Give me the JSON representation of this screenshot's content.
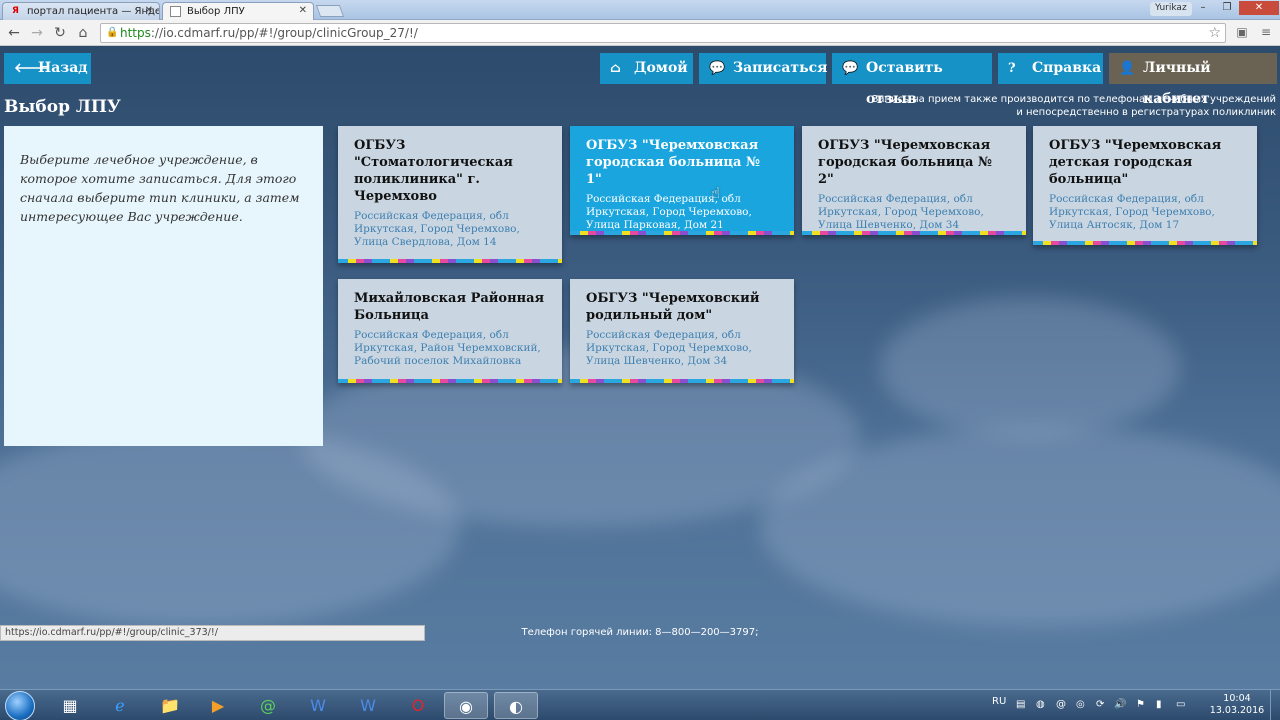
{
  "browser": {
    "tabs": [
      {
        "title": "портал пациента — Янде",
        "icon": "yandex-icon"
      },
      {
        "title": "Выбор ЛПУ",
        "icon": "page-icon"
      }
    ],
    "user_badge": "Yurikaz",
    "url_scheme": "https",
    "url_rest": "://io.cdmarf.ru/pp/#!/group/clinicGroup_27/!/",
    "status_url": "https://io.cdmarf.ru/pp/#!/group/clinic_373/!/"
  },
  "nav": {
    "back": "Назад",
    "home": "Домой",
    "signup": "Записаться",
    "feedback": "Оставить отзыв",
    "help": "Справка",
    "cabinet": "Личный кабинет"
  },
  "page": {
    "title": "Выбор ЛПУ",
    "notice_line1": "Запись на прием также производится по телефонам лечебных учреждений",
    "notice_line2": "и непосредственно в регистратурах поликлиник",
    "intro": "Выберите лечебное учреждение, в которое хотите записаться. Для этого сначала выберите тип клиники, а затем интересующее Вас учреждение.",
    "hotline": "Телефон горячей линии: 8—800—200—3797;"
  },
  "clinics": [
    {
      "title": "ОГБУЗ \"Стоматологическая поликлиника\" г. Черемхово",
      "address": "Российская Федерация, обл Иркутская, Город Черемхово, Улица Свердлова, Дом 14"
    },
    {
      "title": "ОГБУЗ \"Черемховская городская больница № 1\"",
      "address": "Российская Федерация, обл Иркутская, Город Черемхово, Улица Парковая, Дом 21"
    },
    {
      "title": "ОГБУЗ \"Черемховская городская больница № 2\"",
      "address": "Российская Федерация, обл Иркутская, Город Черемхово, Улица Шевченко, Дом 34"
    },
    {
      "title": "ОГБУЗ \"Черемховская детская городская больница\"",
      "address": "Российская Федерация, обл Иркутская, Город Черемхово, Улица Антосяк, Дом 17"
    },
    {
      "title": "Михайловская Районная Больница",
      "address": "Российская Федерация, обл Иркутская, Район Черемховский, Рабочий поселок Михайловка"
    },
    {
      "title": "ОБГУЗ \"Черемховский родильный дом\"",
      "address": "Российская Федерация, обл Иркутская, Город Черемхово, Улица Шевченко, Дом 34"
    }
  ],
  "taskbar": {
    "lang": "RU",
    "time": "10:04",
    "date": "13.03.2016"
  }
}
